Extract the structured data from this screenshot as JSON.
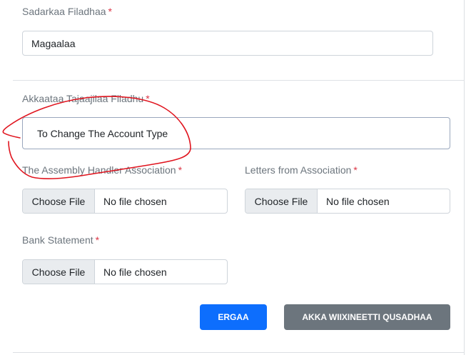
{
  "form": {
    "file_title": {
      "label": "Sadarkaa Filadhaa",
      "value": "Magaalaa"
    },
    "file_type": {
      "label": "Akkaataa Tajaajilaa Filadhu",
      "value": "To Change The Account Type"
    },
    "assembly_file": {
      "label": "The Assembly Handler Association",
      "button": "Choose File",
      "status": "No file chosen"
    },
    "letters_file": {
      "label": "Letters from Association",
      "button": "Choose File",
      "status": "No file chosen"
    },
    "bank_file": {
      "label": "Bank Statement",
      "button": "Choose File",
      "status": "No file chosen"
    },
    "required_marker": "*"
  },
  "actions": {
    "submit_label": "ERGAA",
    "cancel_label": "AKKA WIIXINEETTI QUSADHAA"
  },
  "colors": {
    "primary": "#0d6efd",
    "secondary": "#6c757d",
    "required": "#dc3545",
    "annotation": "#e0141e"
  }
}
